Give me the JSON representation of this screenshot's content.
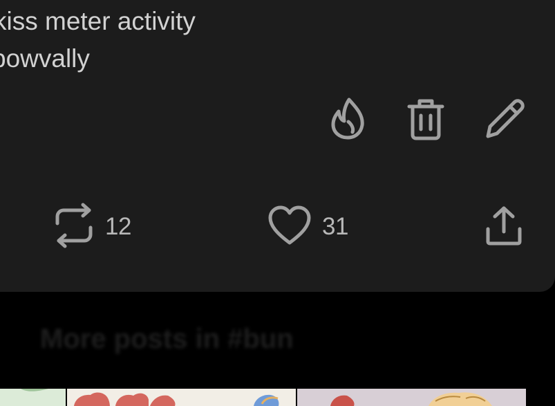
{
  "post": {
    "tags": [
      "kiss meter activity",
      "bowvally"
    ],
    "owner_actions": [
      "blaze-icon",
      "delete-icon",
      "edit-icon"
    ],
    "footer": {
      "reblog_count": "12",
      "like_count": "31"
    }
  },
  "more_posts": {
    "heading": "More posts in #bun"
  },
  "colors": {
    "card_background": "#1c1c1c",
    "page_background": "#000000",
    "icon_color": "#a0a0a0",
    "text_color": "#d2d2d2"
  }
}
